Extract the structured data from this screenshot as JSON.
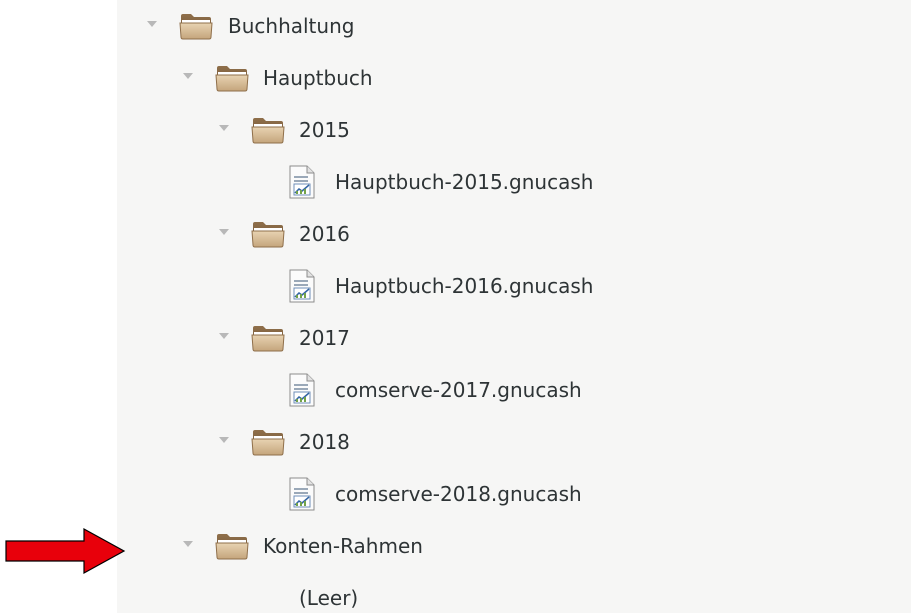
{
  "tree": {
    "buchhaltung": {
      "label": "Buchhaltung",
      "icon": "folder-icon"
    },
    "hauptbuch": {
      "label": "Hauptbuch",
      "icon": "folder-icon"
    },
    "y2015": {
      "label": "2015",
      "icon": "folder-icon"
    },
    "file_2015": {
      "label": "Hauptbuch-2015.gnucash",
      "icon": "gnucash-file-icon"
    },
    "y2016": {
      "label": "2016",
      "icon": "folder-icon"
    },
    "file_2016": {
      "label": "Hauptbuch-2016.gnucash",
      "icon": "gnucash-file-icon"
    },
    "y2017": {
      "label": "2017",
      "icon": "folder-icon"
    },
    "file_2017": {
      "label": "comserve-2017.gnucash",
      "icon": "gnucash-file-icon"
    },
    "y2018": {
      "label": "2018",
      "icon": "folder-icon"
    },
    "file_2018": {
      "label": "comserve-2018.gnucash",
      "icon": "gnucash-file-icon"
    },
    "konten_rahmen": {
      "label": "Konten-Rahmen",
      "icon": "folder-icon"
    },
    "leer": {
      "label": "(Leer)"
    }
  },
  "annotation": {
    "icon": "red-arrow",
    "color": "#e8000b"
  },
  "colors": {
    "panel_background": "#f6f6f5",
    "text": "#2e3436",
    "folder": "#c9a87a",
    "expander": "#b8b8b8"
  }
}
